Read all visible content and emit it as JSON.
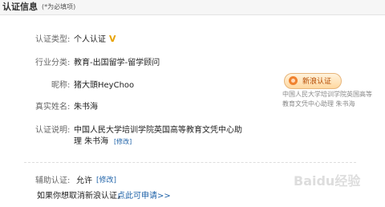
{
  "header": {
    "title": "认证信息",
    "note": "(*为必填项)"
  },
  "fields": {
    "type": {
      "label": "认证类型:",
      "value": "个人认证",
      "badge": "V"
    },
    "industry": {
      "label": "行业分类:",
      "value": "教育-出国留学-留学顾问"
    },
    "nickname": {
      "label": "昵称:",
      "value": "猪大頭HeyChoo"
    },
    "realname": {
      "label": "真实姓名:",
      "value": "朱书海"
    },
    "description": {
      "label": "认证说明:",
      "line1": "中国人民大学培训学院英国高等教育文凭中心助",
      "line2": "理 朱书海",
      "edit": "[修改]"
    }
  },
  "card": {
    "pill_label": "新浪认证",
    "desc": "中国人民大学培训学院英国高等教育文凭中心助理 朱书海"
  },
  "aux": {
    "label": "辅助认证:",
    "value": "允许",
    "edit": "[修改]",
    "cancel_prefix": "如果你想取消新浪认证，",
    "cancel_link": "点此可申请>>"
  },
  "watermark": "Baidu经验"
}
